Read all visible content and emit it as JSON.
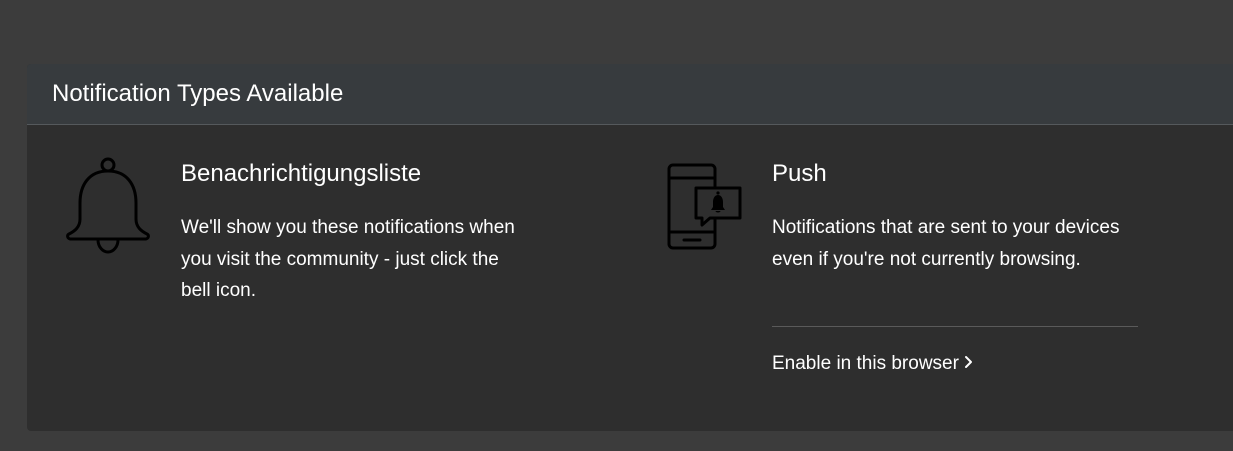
{
  "panel": {
    "title": "Notification Types Available"
  },
  "types": [
    {
      "icon": "bell-icon",
      "title": "Benachrichtigungsliste",
      "description": "We'll show you these notifications when you visit the community - just click the bell icon."
    },
    {
      "icon": "phone-notification-icon",
      "title": "Push",
      "description": "Notifications that are sent to your devices even if you're not currently browsing.",
      "link_label": "Enable in this browser",
      "link_icon": "chevron-right-icon"
    }
  ],
  "colors": {
    "page_background": "#3c3c3c",
    "panel_background": "#2e2e2e",
    "header_background": "#373b3e",
    "text": "#ffffff"
  }
}
